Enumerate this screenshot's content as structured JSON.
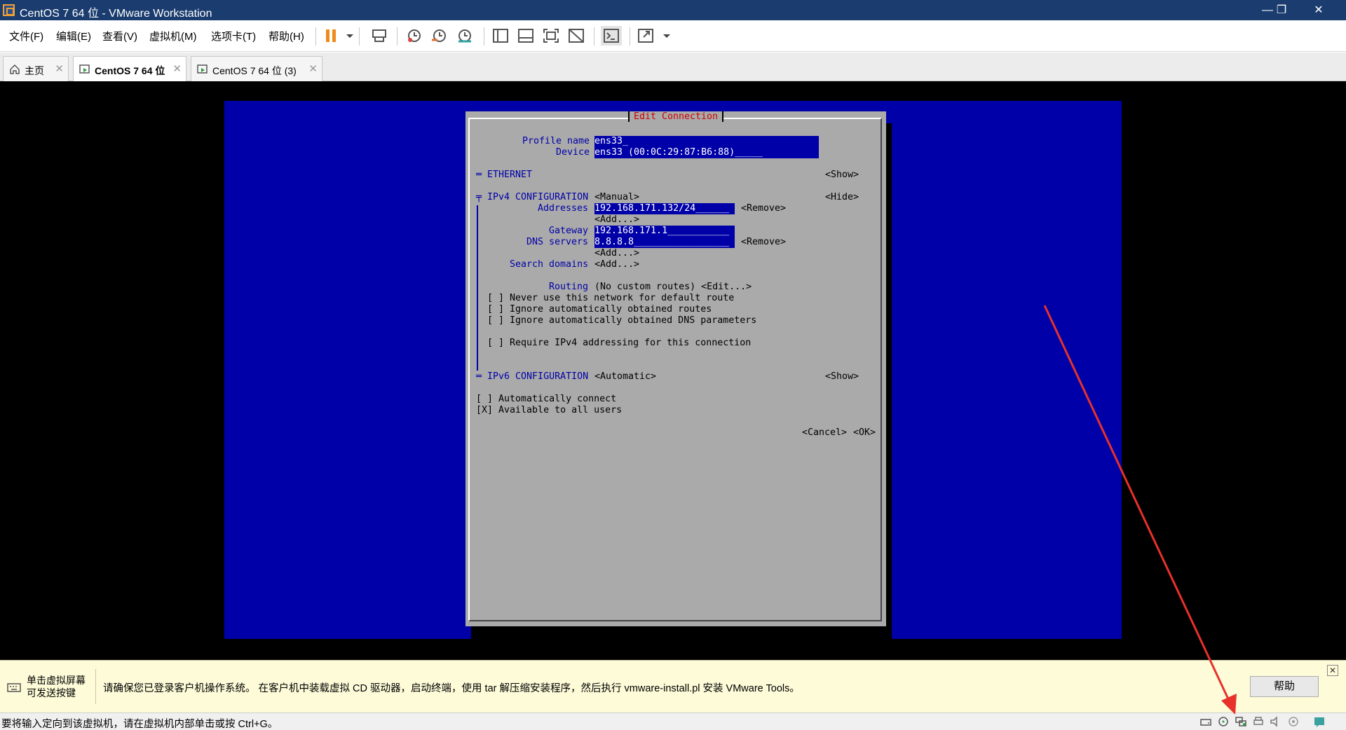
{
  "window": {
    "title": "CentOS 7 64 位 - VMware Workstation",
    "minimize": "—",
    "restore": "❐",
    "close": "✕"
  },
  "menu": [
    "文件(F)",
    "编辑(E)",
    "查看(V)",
    "虚拟机(M)",
    "选项卡(T)",
    "帮助(H)"
  ],
  "tabs": [
    {
      "label": "主页",
      "icon": "home-icon",
      "close": "✕"
    },
    {
      "label": "CentOS 7 64 位",
      "icon": "vm-icon",
      "close": "✕"
    },
    {
      "label": "CentOS 7 64 位 (3)",
      "icon": "vm-icon",
      "close": "✕"
    }
  ],
  "tui": {
    "title": "Edit Connection",
    "profile_name_label": "Profile name",
    "profile_name_value": "ens33_                        ",
    "device_label": "Device",
    "device_value": "ens33 (00:0C:29:87:B6:88)_____",
    "ethernet": "═ ETHERNET",
    "ethernet_toggle": "<Show>",
    "ipv4": "╤ IPv4 CONFIGURATION",
    "ipv4_mode": "<Manual>",
    "ipv4_toggle": "<Hide>",
    "addresses_label": "Addresses",
    "addresses_value": "192.168.171.132/24______",
    "remove1": "<Remove>",
    "add1": "<Add...>",
    "gateway_label": "Gateway",
    "gateway_value": "192.168.171.1___________",
    "dns_label": "DNS servers",
    "dns_value": "8.8.8.8_________________",
    "remove2": "<Remove>",
    "add2": "<Add...>",
    "search_label": "Search domains",
    "add3": "<Add...>",
    "routing_label": "Routing",
    "routing_value": "(No custom routes) <Edit...>",
    "check1": "[ ] Never use this network for default route",
    "check2": "[ ] Ignore automatically obtained routes",
    "check3": "[ ] Ignore automatically obtained DNS parameters",
    "check4": "[ ] Require IPv4 addressing for this connection",
    "ipv6": "═ IPv6 CONFIGURATION",
    "ipv6_mode": "<Automatic>",
    "ipv6_toggle": "<Show>",
    "auto_connect": "[ ] Automatically connect",
    "all_users": "[X] Available to all users",
    "cancel": "<Cancel>",
    "ok": "<OK>"
  },
  "infobar": {
    "hint_line1": "单击虚拟屏幕",
    "hint_line2": "可发送按键",
    "message": "请确保您已登录客户机操作系统。 在客户机中装载虚拟 CD 驱动器，启动终端，使用 tar 解压缩安装程序，然后执行 vmware-install.pl 安装 VMware Tools。",
    "help": "帮助",
    "close": "✕"
  },
  "statusbar": {
    "text": "要将输入定向到该虚拟机，请在虚拟机内部单击或按 Ctrl+G。"
  },
  "colors": {
    "tui_blue": "#0000a8",
    "tui_gray": "#aaaaaa",
    "title_red": "#cc0000",
    "annotation_red": "#e8312a"
  }
}
